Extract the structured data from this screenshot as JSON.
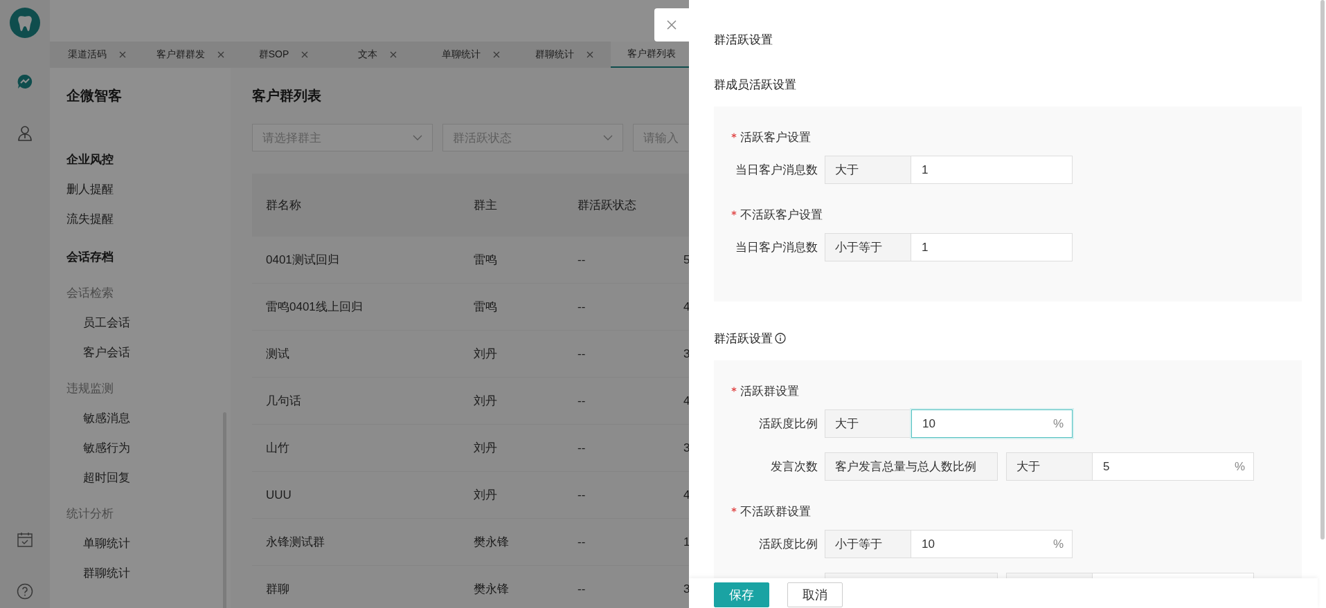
{
  "tabs": [
    {
      "label": "渠道活码",
      "selected": false,
      "closable": true
    },
    {
      "label": "客户群群发",
      "selected": false,
      "closable": true
    },
    {
      "label": "群SOP",
      "selected": false,
      "closable": true
    },
    {
      "label": "文本",
      "selected": false,
      "closable": true
    },
    {
      "label": "单聊统计",
      "selected": false,
      "closable": true
    },
    {
      "label": "群聊统计",
      "selected": false,
      "closable": true
    },
    {
      "label": "客户群列表",
      "selected": true,
      "closable": false
    }
  ],
  "sidebar": {
    "title": "企微智客",
    "sections": [
      {
        "label": "企业风控",
        "children": [
          {
            "label": "删人提醒"
          },
          {
            "label": "流失提醒"
          }
        ]
      },
      {
        "label": "会话存档",
        "children": [
          {
            "label": "会话检索",
            "children": [
              {
                "label": "员工会话"
              },
              {
                "label": "客户会话"
              }
            ]
          },
          {
            "label": "违规监测",
            "children": [
              {
                "label": "敏感消息"
              },
              {
                "label": "敏感行为"
              },
              {
                "label": "超时回复"
              }
            ]
          },
          {
            "label": "统计分析",
            "children": [
              {
                "label": "单聊统计"
              },
              {
                "label": "群聊统计"
              }
            ]
          }
        ]
      }
    ]
  },
  "page": {
    "title": "客户群列表",
    "filters": [
      {
        "kind": "select",
        "placeholder": "请选择群主"
      },
      {
        "kind": "select",
        "placeholder": "群活跃状态"
      },
      {
        "kind": "input",
        "placeholder": "请输入"
      }
    ]
  },
  "table": {
    "columns": [
      "群名称",
      "群主",
      "群活跃状态"
    ],
    "rows": [
      [
        "0401测试回归",
        "雷鸣",
        "--",
        "5"
      ],
      [
        "雷鸣0401线上回归",
        "雷鸣",
        "--",
        "4"
      ],
      [
        "测试",
        "刘丹",
        "--",
        "3"
      ],
      [
        "几句话",
        "刘丹",
        "--",
        "4"
      ],
      [
        "山竹",
        "刘丹",
        "--",
        "3"
      ],
      [
        "UUU",
        "刘丹",
        "--",
        "4"
      ],
      [
        "永锋测试群",
        "樊永锋",
        "--",
        "1"
      ],
      [
        "群聊",
        "樊永锋",
        "--",
        "3"
      ]
    ]
  },
  "drawer": {
    "title": "群活跃设置",
    "sections": [
      {
        "title": "群成员活跃设置",
        "info": false,
        "groups": [
          {
            "title": "活跃客户设置",
            "required": true,
            "rows": [
              {
                "label": "当日客户消息数",
                "parts": [
                  {
                    "kind": "addon",
                    "text": "大于"
                  },
                  {
                    "kind": "input",
                    "value": "1",
                    "focused": false
                  }
                ]
              }
            ]
          },
          {
            "title": "不活跃客户设置",
            "required": true,
            "rows": [
              {
                "label": "当日客户消息数",
                "parts": [
                  {
                    "kind": "addon",
                    "text": "小于等于"
                  },
                  {
                    "kind": "input",
                    "value": "1",
                    "focused": false
                  }
                ]
              }
            ]
          }
        ]
      },
      {
        "title": "群活跃设置",
        "info": true,
        "groups": [
          {
            "title": "活跃群设置",
            "required": true,
            "rows": [
              {
                "label": "活跃度比例",
                "parts": [
                  {
                    "kind": "addon",
                    "text": "大于"
                  },
                  {
                    "kind": "input",
                    "value": "10",
                    "suffix": "%",
                    "focused": true
                  }
                ]
              },
              {
                "label": "发言次数",
                "parts": [
                  {
                    "kind": "wide-addon",
                    "text": "客户发言总量与总人数比例"
                  },
                  {
                    "kind": "addon",
                    "text": "大于"
                  },
                  {
                    "kind": "input",
                    "value": "5",
                    "suffix": "%",
                    "focused": false
                  }
                ]
              }
            ]
          },
          {
            "title": "不活跃群设置",
            "required": true,
            "rows": [
              {
                "label": "活跃度比例",
                "parts": [
                  {
                    "kind": "addon",
                    "text": "小于等于"
                  },
                  {
                    "kind": "input",
                    "value": "10",
                    "suffix": "%",
                    "focused": false
                  }
                ]
              },
              {
                "parts": [
                  {
                    "kind": "wide-addon"
                  },
                  {
                    "kind": "addon"
                  },
                  {
                    "kind": "input"
                  }
                ]
              }
            ]
          }
        ]
      }
    ],
    "buttons": [
      {
        "label": "保存",
        "kind": "primary"
      },
      {
        "label": "取消",
        "kind": "default"
      }
    ]
  }
}
